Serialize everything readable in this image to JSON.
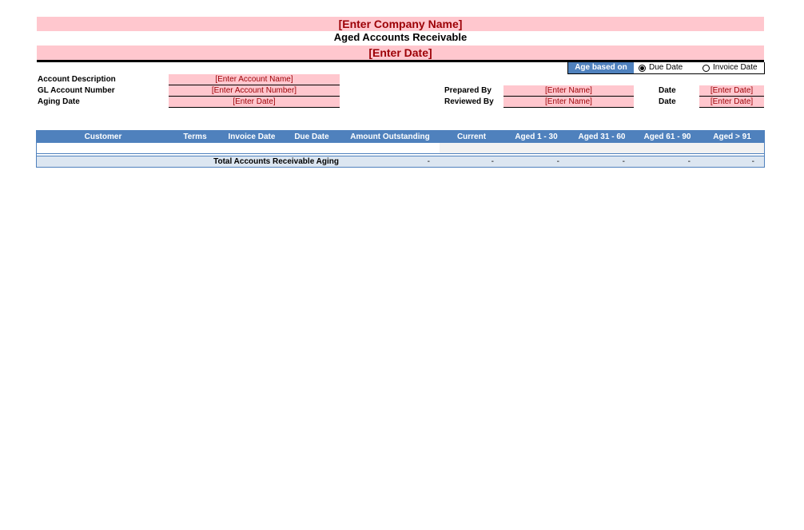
{
  "header": {
    "company": "[Enter Company Name]",
    "report_title": "Aged Accounts Receivable",
    "date": "[Enter Date]"
  },
  "age_based_on": {
    "label": "Age based on",
    "options": [
      {
        "label": "Due Date",
        "selected": true
      },
      {
        "label": "Invoice Date",
        "selected": false
      }
    ]
  },
  "account": {
    "description_label": "Account Description",
    "description_value": "[Enter Account Name]",
    "gl_label": "GL Account Number",
    "gl_value": "[Enter Account Number]",
    "aging_label": "Aging Date",
    "aging_value": "[Enter Date]"
  },
  "signoff": {
    "prepared_label": "Prepared By",
    "prepared_value": "[Enter Name]",
    "reviewed_label": "Reviewed By",
    "reviewed_value": "[Enter Name]",
    "date_label_1": "Date",
    "date_value_1": "[Enter Date]",
    "date_label_2": "Date",
    "date_value_2": "[Enter Date]"
  },
  "table": {
    "columns": [
      "Customer",
      "Terms",
      "Invoice Date",
      "Due Date",
      "Amount Outstanding",
      "Current",
      "Aged 1 - 30",
      "Aged 31 - 60",
      "Aged 61 - 90",
      "Aged > 91"
    ],
    "total_label": "Total Accounts Receivable Aging",
    "totals": [
      "-",
      "-",
      "-",
      "-",
      "-",
      "-"
    ]
  },
  "colors": {
    "accent_blue": "#4f81bd",
    "input_pink": "#ffc7ce",
    "input_text": "#9c0006",
    "total_row": "#dce6f1"
  }
}
